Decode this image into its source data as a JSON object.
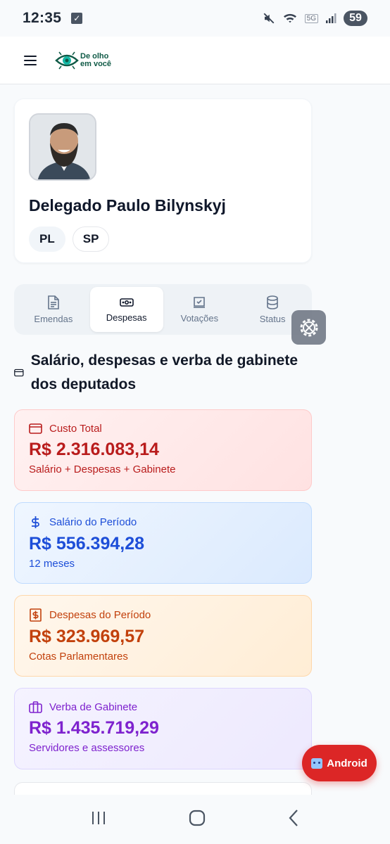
{
  "status_bar": {
    "time": "12:35",
    "battery": "59",
    "network_label": "5G"
  },
  "header": {
    "logo_line1": "De olho",
    "logo_line2": "em você"
  },
  "profile": {
    "name": "Delegado Paulo Bilynskyj",
    "tags": [
      "PL",
      "SP"
    ]
  },
  "tabs": [
    {
      "label": "Emendas",
      "icon": "file-text-icon",
      "active": false
    },
    {
      "label": "Despesas",
      "icon": "banknote-icon",
      "active": true
    },
    {
      "label": "Votações",
      "icon": "vote-box-icon",
      "active": false
    },
    {
      "label": "Status",
      "icon": "database-icon",
      "active": false
    }
  ],
  "section": {
    "title": "Salário, despesas e verba de gabinete dos deputados"
  },
  "metrics": {
    "total": {
      "label": "Custo Total",
      "value": "R$ 2.316.083,14",
      "sub": "Salário + Despesas + Gabinete",
      "icon": "credit-card-icon"
    },
    "salario": {
      "label": "Salário do Período",
      "value": "R$ 556.394,28",
      "sub": "12 meses",
      "icon": "dollar-sign-icon"
    },
    "despesas": {
      "label": "Despesas do Período",
      "value": "R$ 323.969,57",
      "sub": "Cotas Parlamentares",
      "icon": "receipt-dollar-icon"
    },
    "verba": {
      "label": "Verba de Gabinete",
      "value": "R$ 1.435.719,29",
      "sub": "Servidores e assessores",
      "icon": "briefcase-icon"
    }
  },
  "floating": {
    "android_label": "Android"
  },
  "colors": {
    "accent_red": "#dc2626",
    "total": "#b91c1c",
    "salario": "#1d4ed8",
    "despesas": "#c2410c",
    "verba": "#7e22ce",
    "logo_green": "#0f5a46"
  }
}
